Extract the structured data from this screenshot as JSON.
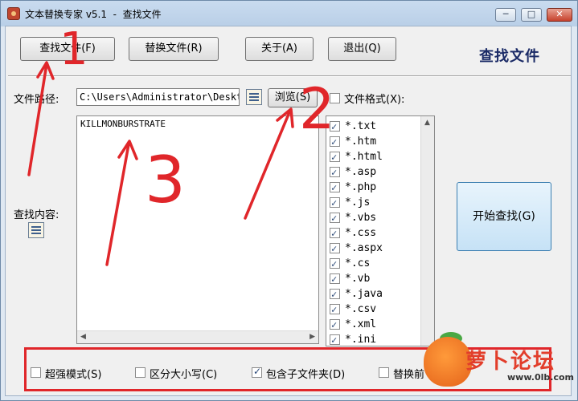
{
  "window": {
    "title": "文本替换专家 v5.1  -  查找文件",
    "controls": {
      "minimize": "─",
      "maximize": "□",
      "close": "✕"
    }
  },
  "toolbar": {
    "find_files": "查找文件(F)",
    "replace_files": "替换文件(R)",
    "about": "关于(A)",
    "exit": "退出(Q)",
    "page_title": "查找文件"
  },
  "path": {
    "label": "文件路径:",
    "value": "C:\\Users\\Administrator\\Desktop",
    "browse": "浏览(S)"
  },
  "file_format": {
    "label": "文件格式(X):",
    "checked": false,
    "items": [
      "*.txt",
      "*.htm",
      "*.html",
      "*.asp",
      "*.php",
      "*.js",
      "*.vbs",
      "*.css",
      "*.aspx",
      "*.cs",
      "*.vb",
      "*.java",
      "*.csv",
      "*.xml",
      "*.ini"
    ]
  },
  "search": {
    "label": "查找内容:",
    "content": "KILLMONBURSTRATE"
  },
  "start_button": "开始查找(G)",
  "options": [
    {
      "label": "超强模式(S)",
      "checked": false
    },
    {
      "label": "区分大小写(C)",
      "checked": false
    },
    {
      "label": "包含子文件夹(D)",
      "checked": true
    },
    {
      "label": "替换前",
      "checked": false
    }
  ],
  "annotations": [
    "1",
    "2",
    "3"
  ],
  "watermark": {
    "text": "萝卜论坛",
    "url": "www.0lb.com"
  },
  "colors": {
    "annotation": "#e0262a",
    "accent": "#1a2a66"
  }
}
